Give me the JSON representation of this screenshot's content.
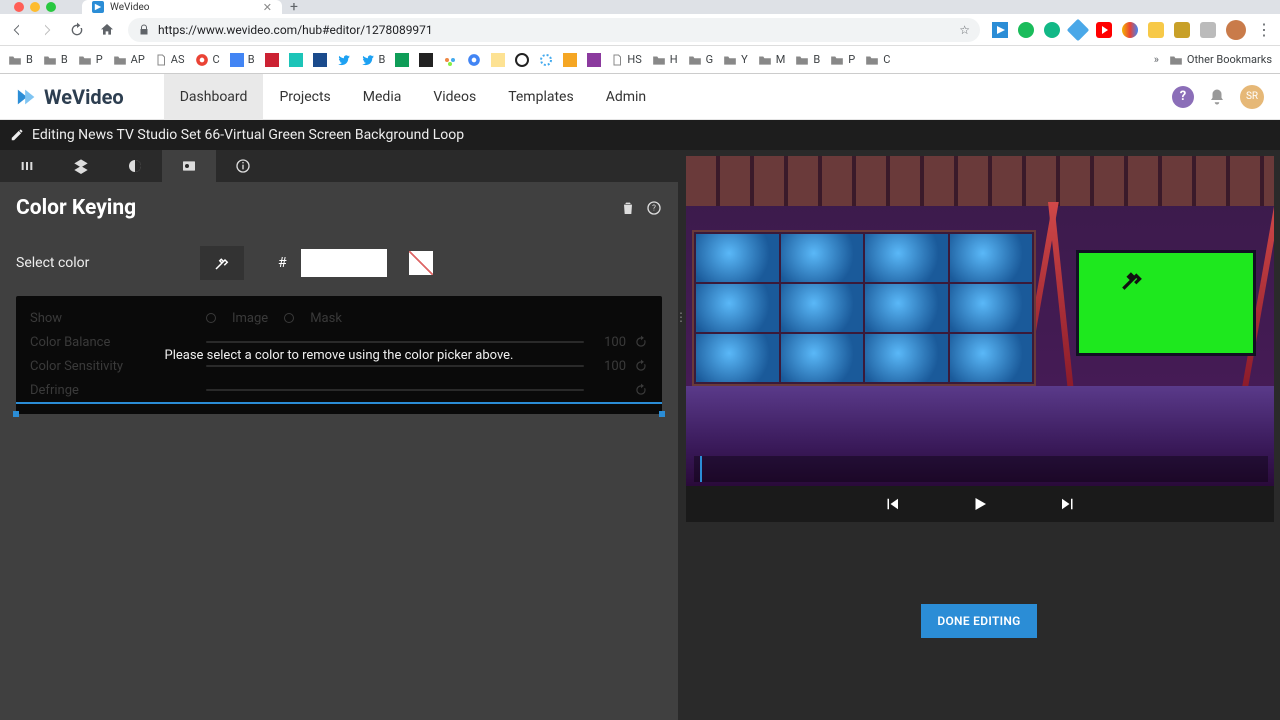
{
  "browser": {
    "tab_title": "WeVideo",
    "url": "https://www.wevideo.com/hub#editor/1278089971",
    "other_bookmarks": "Other Bookmarks",
    "bookmarks": [
      "B",
      "B",
      "P",
      "AP",
      "AS",
      "C",
      "B",
      "",
      "",
      "",
      "B",
      "B",
      "",
      "",
      "",
      "",
      "",
      "",
      "HS",
      "H",
      "G",
      "Y",
      "M",
      "B",
      "P",
      "C"
    ]
  },
  "app": {
    "brand": "WeVideo",
    "nav": [
      "Dashboard",
      "Projects",
      "Media",
      "Videos",
      "Templates",
      "Admin"
    ],
    "nav_active_index": 0,
    "user_initials": "SR"
  },
  "editor": {
    "title": "Editing News TV Studio Set 66-Virtual Green Screen Background Loop",
    "panel_title": "Color Keying",
    "select_label": "Select color",
    "hash": "#",
    "hex_value": "",
    "overlay_msg": "Please select a color to remove using the color picker above.",
    "dim_rows": {
      "show": "Show",
      "image": "Image",
      "mask": "Mask",
      "balance": "Color Balance",
      "sensitivity": "Color Sensitivity",
      "defringe": "Defringe",
      "val100": "100"
    },
    "done_label": "DONE EDITING"
  }
}
